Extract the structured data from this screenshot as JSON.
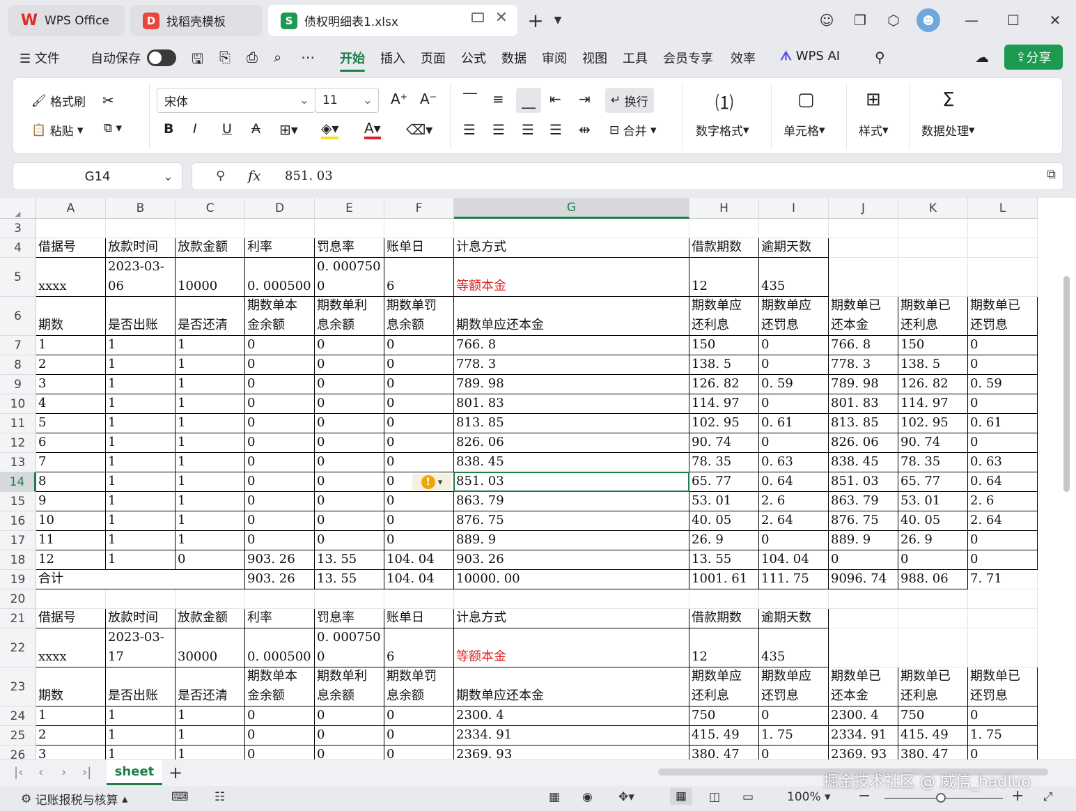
{
  "titlebar": {
    "app_tab": "WPS Office",
    "template_tab": "找稻壳模板",
    "file_tab": "债权明细表1.xlsx",
    "add_tab": "+"
  },
  "menu": {
    "file": "文件",
    "autosave": "自动保存",
    "items": [
      "开始",
      "插入",
      "页面",
      "公式",
      "数据",
      "审阅",
      "视图",
      "工具",
      "会员专享",
      "效率"
    ],
    "active": "开始",
    "wps_ai": "WPS AI",
    "share": "分享"
  },
  "ribbon": {
    "format_painter": "格式刷",
    "paste": "粘贴",
    "font_name": "宋体",
    "font_size": "11",
    "wrap": "换行",
    "merge": "合并",
    "number_format": "数字格式",
    "cell": "单元格",
    "style": "样式",
    "data_process": "数据处理"
  },
  "formula_bar": {
    "name_box": "G14",
    "fx": "fx",
    "value": "851. 03"
  },
  "grid": {
    "columns": [
      "A",
      "B",
      "C",
      "D",
      "E",
      "F",
      "G",
      "H",
      "I",
      "J",
      "K",
      "L"
    ],
    "rows": [
      "3",
      "4",
      "5",
      "6",
      "7",
      "8",
      "9",
      "10",
      "11",
      "12",
      "13",
      "14",
      "15",
      "16",
      "17",
      "18",
      "19",
      "20",
      "21",
      "22",
      "23",
      "24",
      "25",
      "26"
    ],
    "selected_col": "G",
    "selected_row": "14",
    "cells": {
      "r4": [
        "借据号",
        "放款时间",
        "放款金额",
        "利率",
        "罚息率",
        "账单日",
        "计息方式",
        "借款期数",
        "逾期天数"
      ],
      "r5": [
        "xxxx",
        "2023-03-\n06",
        "10000",
        "0. 000500",
        "0. 000750\n0",
        "6",
        "等额本金",
        "12",
        "435"
      ],
      "r6": [
        "期数",
        "是否出账",
        "是否还清",
        "期数单本\n金余额",
        "期数单利\n息余额",
        "期数单罚\n息余额",
        "期数单应还本金",
        "期数单应\n还利息",
        "期数单应\n还罚息",
        "期数单已\n还本金",
        "期数单已\n还利息",
        "期数单已\n还罚息"
      ],
      "r7": [
        "1",
        "1",
        "1",
        "0",
        "0",
        "0",
        "766. 8",
        "150",
        "0",
        "766. 8",
        "150",
        "0"
      ],
      "r8": [
        "2",
        "1",
        "1",
        "0",
        "0",
        "0",
        "778. 3",
        "138. 5",
        "0",
        "778. 3",
        "138. 5",
        "0"
      ],
      "r9": [
        "3",
        "1",
        "1",
        "0",
        "0",
        "0",
        "789. 98",
        "126. 82",
        "0. 59",
        "789. 98",
        "126. 82",
        "0. 59"
      ],
      "r10": [
        "4",
        "1",
        "1",
        "0",
        "0",
        "0",
        "801. 83",
        "114. 97",
        "0",
        "801. 83",
        "114. 97",
        "0"
      ],
      "r11": [
        "5",
        "1",
        "1",
        "0",
        "0",
        "0",
        "813. 85",
        "102. 95",
        "0. 61",
        "813. 85",
        "102. 95",
        "0. 61"
      ],
      "r12": [
        "6",
        "1",
        "1",
        "0",
        "0",
        "0",
        "826. 06",
        "90. 74",
        "0",
        "826. 06",
        "90. 74",
        "0"
      ],
      "r13": [
        "7",
        "1",
        "1",
        "0",
        "0",
        "0",
        "838. 45",
        "78. 35",
        "0. 63",
        "838. 45",
        "78. 35",
        "0. 63"
      ],
      "r14": [
        "8",
        "1",
        "1",
        "0",
        "0",
        "0",
        "851. 03",
        "65. 77",
        "0. 64",
        "851. 03",
        "65. 77",
        "0. 64"
      ],
      "r15": [
        "9",
        "1",
        "1",
        "0",
        "0",
        "0",
        "863. 79",
        "53. 01",
        "2. 6",
        "863. 79",
        "53. 01",
        "2. 6"
      ],
      "r16": [
        "10",
        "1",
        "1",
        "0",
        "0",
        "0",
        "876. 75",
        "40. 05",
        "2. 64",
        "876. 75",
        "40. 05",
        "2. 64"
      ],
      "r17": [
        "11",
        "1",
        "1",
        "0",
        "0",
        "0",
        "889. 9",
        "26. 9",
        "0",
        "889. 9",
        "26. 9",
        "0"
      ],
      "r18": [
        "12",
        "1",
        "0",
        "903. 26",
        "13. 55",
        "104. 04",
        "903. 26",
        "13. 55",
        "104. 04",
        "0",
        "0",
        "0"
      ],
      "r19": [
        "合计",
        "903. 26",
        "13. 55",
        "104. 04",
        "10000. 00",
        "1001. 61",
        "111. 75",
        "9096. 74",
        "988. 06",
        "7. 71"
      ],
      "r21": [
        "借据号",
        "放款时间",
        "放款金额",
        "利率",
        "罚息率",
        "账单日",
        "计息方式",
        "借款期数",
        "逾期天数"
      ],
      "r22": [
        "xxxx",
        "2023-03-\n17",
        "30000",
        "0. 000500",
        "0. 000750\n0",
        "6",
        "等额本金",
        "12",
        "435"
      ],
      "r23": [
        "期数",
        "是否出账",
        "是否还清",
        "期数单本\n金余额",
        "期数单利\n息余额",
        "期数单罚\n息余额",
        "期数单应还本金",
        "期数单应\n还利息",
        "期数单应\n还罚息",
        "期数单已\n还本金",
        "期数单已\n还利息",
        "期数单已\n还罚息"
      ],
      "r24": [
        "1",
        "1",
        "1",
        "0",
        "0",
        "0",
        "2300. 4",
        "750",
        "0",
        "2300. 4",
        "750",
        "0"
      ],
      "r25": [
        "2",
        "1",
        "1",
        "0",
        "0",
        "0",
        "2334. 91",
        "415. 49",
        "1. 75",
        "2334. 91",
        "415. 49",
        "1. 75"
      ],
      "r26": [
        "3",
        "1",
        "1",
        "0",
        "0",
        "0",
        "2369. 93",
        "380. 47",
        "0",
        "2369. 93",
        "380. 47",
        "0"
      ]
    }
  },
  "sheetbar": {
    "sheet_name": "sheet",
    "add": "+"
  },
  "statusbar": {
    "left_tool": "记账报税与核算",
    "zoom": "100%",
    "watermark": "掘金技术社区 @ 威信_hadluo"
  }
}
